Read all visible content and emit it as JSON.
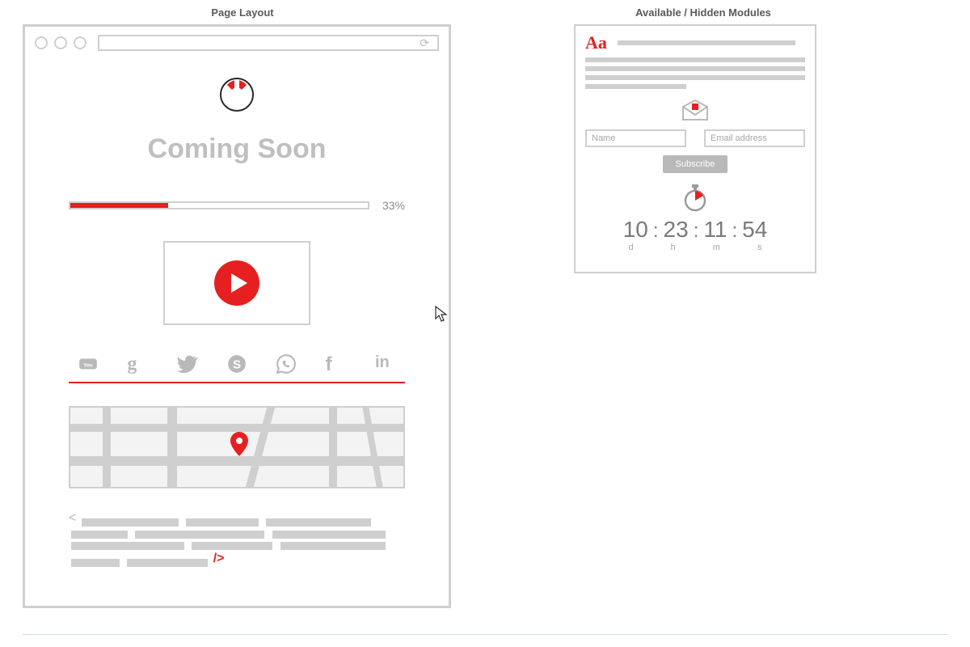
{
  "titles": {
    "left": "Page Layout",
    "right": "Available / Hidden Modules"
  },
  "page": {
    "headline": "Coming Soon",
    "progress": {
      "percent": 33,
      "label": "33%"
    },
    "social": [
      "youtube",
      "google",
      "twitter",
      "skype",
      "whatsapp",
      "facebook",
      "linkedin"
    ],
    "html_open": "<",
    "html_close": "/>"
  },
  "modules": {
    "text": {
      "symbol": "Aa"
    },
    "form": {
      "name_placeholder": "Name",
      "email_placeholder": "Email address",
      "button_label": "Subscribe"
    },
    "countdown": {
      "d": "10",
      "h": "23",
      "m": "11",
      "s": "54",
      "labels": {
        "d": "d",
        "h": "h",
        "m": "m",
        "s": "s"
      }
    }
  },
  "colors": {
    "accent": "#e62020",
    "muted": "#cfcfcf"
  }
}
